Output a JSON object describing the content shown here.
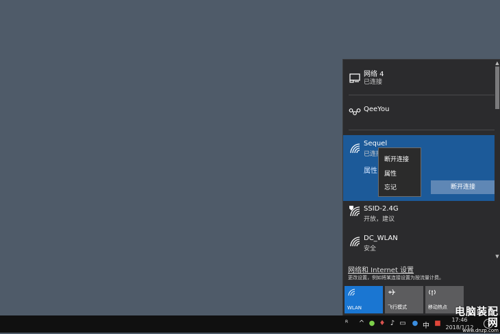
{
  "flyout": {
    "networks": [
      {
        "name": "网络 4",
        "status": "已连接",
        "icon": "ethernet-monitor-icon"
      },
      {
        "name": "QeeYou",
        "status": "",
        "icon": "vpn-nodes-icon"
      },
      {
        "name": "Sequel",
        "status": "已连接",
        "icon": "wifi-icon",
        "selected": true,
        "properties_label": "属性",
        "disconnect_label": "断开连接"
      },
      {
        "name": "SSID-2.4G",
        "status": "开放，建议",
        "icon": "wifi-unsecured-icon"
      },
      {
        "name": "DC_WLAN",
        "status": "安全",
        "icon": "wifi-icon"
      }
    ],
    "settings_link": "网络和 Internet 设置",
    "settings_desc": "更改设置，例如将某连接设置为按流量计费。",
    "quick_actions": [
      {
        "label": "WLAN",
        "icon": "wifi-icon",
        "active": true
      },
      {
        "label": "飞行模式",
        "icon": "airplane-icon",
        "active": false
      },
      {
        "label": "移动热点",
        "icon": "hotspot-icon",
        "active": false
      }
    ]
  },
  "context_menu": {
    "items": [
      "断开连接",
      "属性",
      "忘记"
    ]
  },
  "taskbar": {
    "ime": "中",
    "time": "17:46",
    "date": "2018/1/12"
  },
  "watermark": {
    "title": "电脑装配网",
    "url": "www.dnzp.com"
  },
  "colors": {
    "desktop": "#4f5b69",
    "flyout_bg": "#2b2b2d",
    "selected_bg": "#1c5a99",
    "accent": "#1a76d2",
    "taskbar": "#101010"
  }
}
